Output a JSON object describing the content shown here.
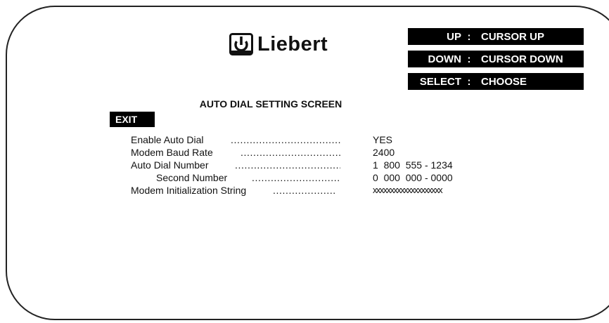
{
  "brand": {
    "name": "Liebert",
    "logo_icon": "liebert-power-logo-icon"
  },
  "key_legend": [
    {
      "key": "UP",
      "separator": ":",
      "action": "CURSOR UP"
    },
    {
      "key": "DOWN",
      "separator": ":",
      "action": "CURSOR DOWN"
    },
    {
      "key": "SELECT",
      "separator": ":",
      "action": "CHOOSE"
    }
  ],
  "screen": {
    "title": "AUTO DIAL SETTING SCREEN",
    "exit_label": "EXIT"
  },
  "settings": [
    {
      "label": "Enable Auto Dial",
      "dots": "....................................",
      "value": "YES"
    },
    {
      "label": "Modem Baud Rate",
      "dots": "................................",
      "value": "2400"
    },
    {
      "label": "Auto Dial Number",
      "dots": "..................................",
      "value": "1  800  555 - 1234"
    },
    {
      "label": "Second Number",
      "dots": "..............................",
      "value": "0  000  000 - 0000"
    },
    {
      "label": "Modem Initialization String",
      "dots": "....................",
      "value": "xxxxxxxxxxxxxxxxxxxx"
    }
  ],
  "colors": {
    "background": "#ffffff",
    "text": "#111111",
    "label_block": "#000000",
    "label_text": "#ffffff"
  }
}
